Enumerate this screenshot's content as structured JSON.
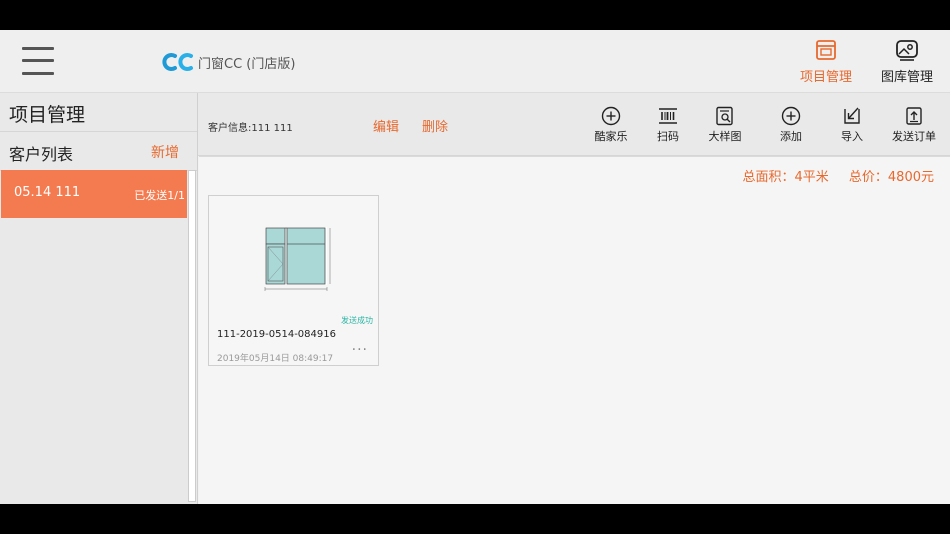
{
  "app": {
    "logo_icon": "cc-logo-icon",
    "logo_text": "门窗CC (门店版)",
    "menu_icon": "hamburger-menu-icon",
    "nav_tabs": [
      {
        "label": "项目管理",
        "icon": "project-window-icon",
        "active": true
      },
      {
        "label": "图库管理",
        "icon": "gallery-icon",
        "active": false
      }
    ],
    "accent_color": "#e8692e"
  },
  "sidebar": {
    "title": "项目管理",
    "list_header": "客户列表",
    "add_label": "新增",
    "customers": [
      {
        "name": "05.14 111",
        "status": "已发送1/1",
        "selected": true
      }
    ]
  },
  "toolbar": {
    "customer_info": "客户信息:111 111",
    "edit_label": "编辑",
    "delete_label": "删除",
    "buttons": [
      {
        "label": "酷家乐",
        "icon": "plus-circle-icon"
      },
      {
        "label": "扫码",
        "icon": "barcode-scan-icon"
      },
      {
        "label": "大样图",
        "icon": "document-search-icon"
      },
      {
        "label": "添加",
        "icon": "plus-circle-icon"
      },
      {
        "label": "导入",
        "icon": "import-arrow-icon"
      },
      {
        "label": "发送订单",
        "icon": "send-order-icon"
      }
    ]
  },
  "main": {
    "total_area": "总面积：4平米",
    "total_price": "总价：4800元",
    "orders": [
      {
        "title": "111-2019-0514-084916",
        "status": "发送成功",
        "date": "2019年05月14日 08:49:17",
        "more": "···",
        "thumb_icon": "window-design-thumbnail"
      }
    ]
  }
}
